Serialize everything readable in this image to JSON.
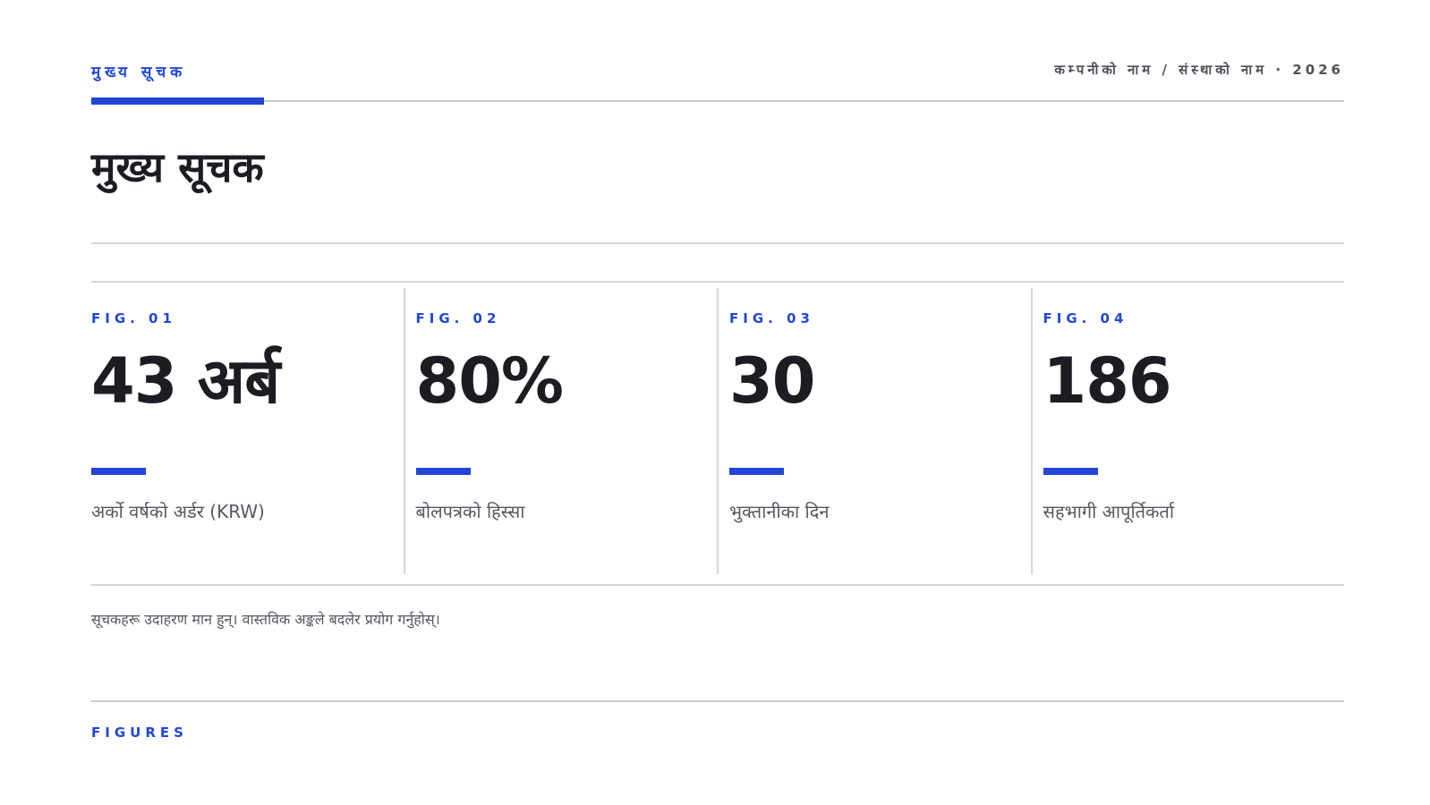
{
  "header": {
    "section_label": "मुख्य सूचक",
    "org_label": "कम्पनीको नाम / संस्थाको नाम · 2026"
  },
  "title": "मुख्य सूचक",
  "metrics": [
    {
      "fig": "FIG. 01",
      "value": "43 अर्ब",
      "caption": "अर्को वर्षको अर्डर (KRW)"
    },
    {
      "fig": "FIG. 02",
      "value": "80%",
      "caption": "बोलपत्रको हिस्सा"
    },
    {
      "fig": "FIG. 03",
      "value": "30",
      "caption": "भुक्तानीका दिन"
    },
    {
      "fig": "FIG. 04",
      "value": "186",
      "caption": "सहभागी आपूर्तिकर्ता"
    }
  ],
  "footnote": "सूचकहरू उदाहरण मान हुन्। वास्तविक अङ्कले बदलेर प्रयोग गर्नुहोस्।",
  "footer": {
    "label": "FIGURES"
  },
  "colors": {
    "accent": "#2147d6",
    "text": "#1b1d22",
    "muted": "#55595f",
    "rule": "#d3d6db"
  }
}
